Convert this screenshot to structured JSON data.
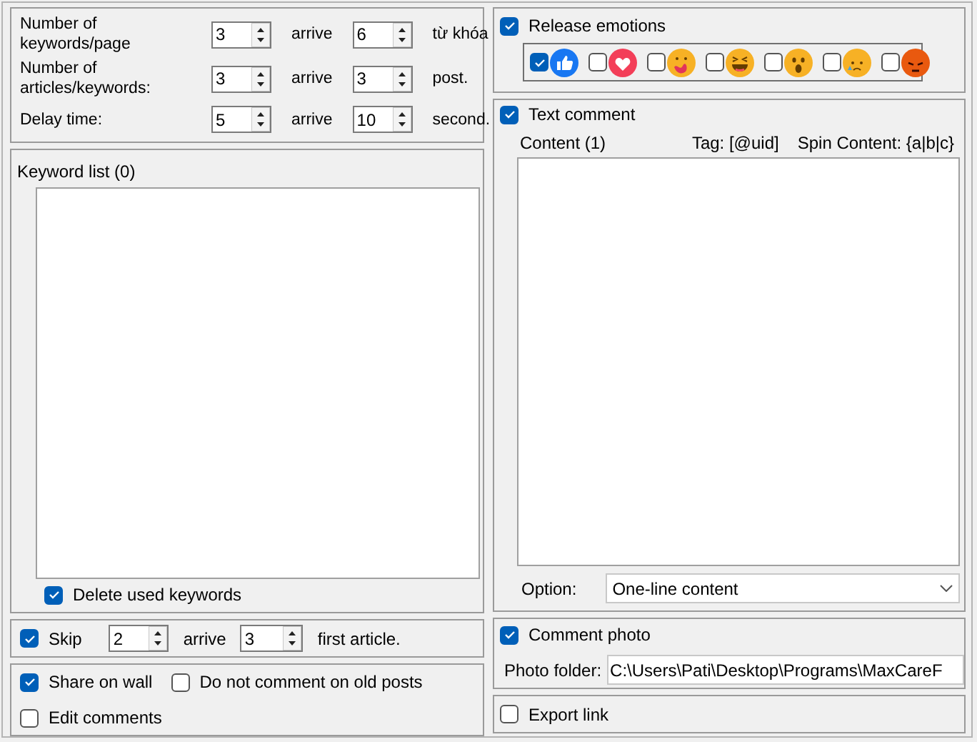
{
  "settings": [
    {
      "label": "Number of keywords/page",
      "from": "3",
      "arrive": "arrive",
      "to": "6",
      "unit": "từ khóa"
    },
    {
      "label": "Number of articles/keywords:",
      "from": "3",
      "arrive": "arrive",
      "to": "3",
      "unit": "post."
    },
    {
      "label": "Delay time:",
      "from": "5",
      "arrive": "arrive",
      "to": "10",
      "unit": "second."
    }
  ],
  "keyword_list": {
    "label": "Keyword list (0)",
    "delete_used": {
      "label": "Delete used keywords",
      "checked": true
    }
  },
  "skip": {
    "label": "Skip",
    "checked": true,
    "from": "2",
    "arrive": "arrive",
    "to": "3",
    "unit": "first article."
  },
  "options": [
    {
      "label": "Share on wall",
      "checked": true
    },
    {
      "label": "Do not comment on old posts",
      "checked": false
    },
    {
      "label": "Edit comments",
      "checked": false
    }
  ],
  "release_emotions": {
    "label": "Release emotions",
    "checked": true,
    "reactions": [
      {
        "kind": "like",
        "checked": true
      },
      {
        "kind": "love",
        "checked": false
      },
      {
        "kind": "care",
        "checked": false
      },
      {
        "kind": "haha",
        "checked": false
      },
      {
        "kind": "wow",
        "checked": false
      },
      {
        "kind": "sad",
        "checked": false
      },
      {
        "kind": "angry",
        "checked": false
      }
    ]
  },
  "text_comment": {
    "label": "Text comment",
    "checked": true,
    "content_label": "Content (1)",
    "tag_hint": "Tag: [@uid]",
    "spin_hint": "Spin Content: {a|b|c}",
    "option_label": "Option:",
    "option_value": "One-line content"
  },
  "comment_photo": {
    "label": "Comment photo",
    "checked": true,
    "folder_label": "Photo folder:",
    "folder_value": "C:\\Users\\Pati\\Desktop\\Programs\\MaxCareF"
  },
  "export_link": {
    "label": "Export link",
    "checked": false
  }
}
